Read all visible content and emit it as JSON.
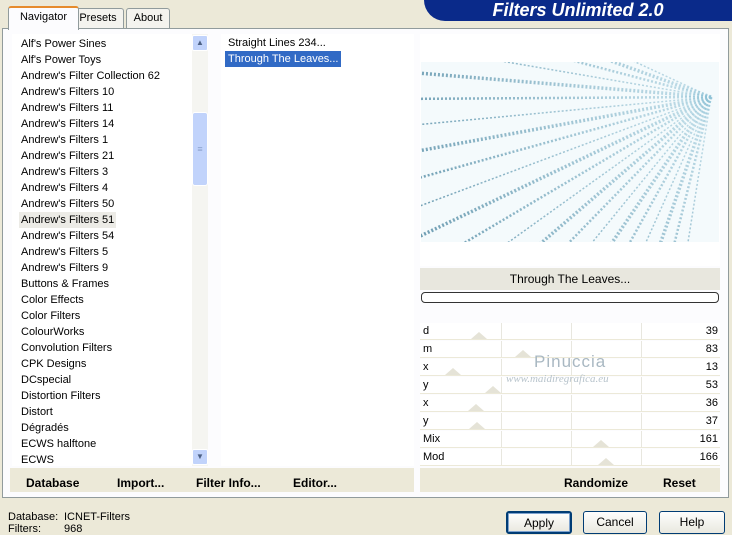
{
  "window": {
    "title": "Filters Unlimited 2.0"
  },
  "tabs": [
    {
      "label": "Navigator",
      "active": true
    },
    {
      "label": "Presets",
      "active": false
    },
    {
      "label": "About",
      "active": false
    }
  ],
  "categories": {
    "items": [
      "Alf's Power Sines",
      "Alf's Power Toys",
      "Andrew's Filter Collection 62",
      "Andrew's Filters 10",
      "Andrew's Filters 11",
      "Andrew's Filters 14",
      "Andrew's Filters 1",
      "Andrew's Filters 21",
      "Andrew's Filters 3",
      "Andrew's Filters 4",
      "Andrew's Filters 50",
      "Andrew's Filters 51",
      "Andrew's Filters 54",
      "Andrew's Filters 5",
      "Andrew's Filters 9",
      "Buttons & Frames",
      "Color Effects",
      "Color Filters",
      "ColourWorks",
      "Convolution Filters",
      "CPK Designs",
      "DCspecial",
      "Distortion Filters",
      "Distort",
      "Dégradés",
      "ECWS halftone",
      "ECWS"
    ],
    "selected": "Andrew's Filters 51"
  },
  "filters": {
    "items": [
      "Straight Lines 234...",
      "Through The Leaves..."
    ],
    "selected": "Through The Leaves..."
  },
  "current_filter": "Through The Leaves...",
  "sliders": [
    {
      "label": "d",
      "value": "39",
      "level": 0.153
    },
    {
      "label": "m",
      "value": "83",
      "level": 0.325
    },
    {
      "label": "x",
      "value": "13",
      "level": 0.051
    },
    {
      "label": "y",
      "value": "53",
      "level": 0.208
    },
    {
      "label": "x",
      "value": "36",
      "level": 0.141
    },
    {
      "label": "y",
      "value": "37",
      "level": 0.145
    },
    {
      "label": "Mix",
      "value": "161",
      "level": 0.631
    },
    {
      "label": "Mod",
      "value": "166",
      "level": 0.651
    }
  ],
  "watermark": {
    "name": "Pinuccia",
    "site": "www.maidiregrafica.eu"
  },
  "toolbar": {
    "database": "Database",
    "import": "Import...",
    "filter_info": "Filter Info...",
    "editor": "Editor...",
    "randomize": "Randomize",
    "reset": "Reset"
  },
  "status": {
    "database_label": "Database:",
    "database_value": "ICNET-Filters",
    "filters_label": "Filters:",
    "filters_value": "968"
  },
  "buttons": {
    "apply": "Apply",
    "cancel": "Cancel",
    "help": "Help"
  },
  "colors": {
    "banner": "#0a2a8a",
    "selection": "#316ac5",
    "window_bg": "#ece9d8"
  }
}
